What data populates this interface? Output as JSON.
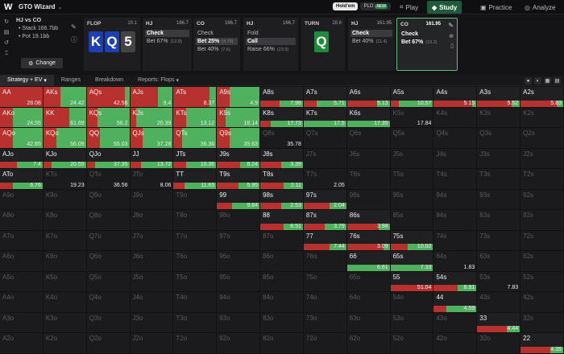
{
  "app": {
    "title": "GTO Wizard"
  },
  "game_toggle": {
    "holdem": "Hold'em",
    "plo": "PLO",
    "plo_badge": "NEW"
  },
  "nav": [
    {
      "label": "Play",
      "icon": "play-icon"
    },
    {
      "label": "Study",
      "icon": "study-icon"
    },
    {
      "label": "Practice",
      "icon": "practice-icon"
    },
    {
      "label": "Analyze",
      "icon": "analyze-icon"
    }
  ],
  "spot": {
    "title": "HJ vs CO",
    "stack": "Stack 166.7bb",
    "pot": "Pot 19.1bb",
    "change_label": "Change"
  },
  "flop": {
    "label": "FLOP",
    "value": "19.1",
    "cards": [
      "K",
      "Q",
      "5"
    ]
  },
  "turn": {
    "label": "TURN",
    "value": "28.6",
    "card": "Q"
  },
  "actions": [
    {
      "pos": "HJ",
      "eq": "166.7",
      "rows": [
        {
          "text": "Check",
          "sub": "",
          "hl": true
        },
        {
          "text": "Bet 67%",
          "sub": "(12.8)",
          "hl": false
        }
      ]
    },
    {
      "pos": "CO",
      "eq": "166.7",
      "rows": [
        {
          "text": "Check",
          "sub": "",
          "hl": false
        },
        {
          "text": "Bet 25%",
          "sub": "(4.75)",
          "hl": true
        },
        {
          "text": "Bet 40%",
          "sub": "(7.6)",
          "hl": false
        }
      ]
    },
    {
      "pos": "HJ",
      "eq": "166.7",
      "rows": [
        {
          "text": "Fold",
          "sub": "",
          "hl": false
        },
        {
          "text": "Call",
          "sub": "",
          "hl": true
        },
        {
          "text": "Raise 66%",
          "sub": "(23.5)",
          "hl": false
        }
      ]
    },
    {
      "pos": "HJ",
      "eq": "161.95",
      "rows": [
        {
          "text": "Check",
          "sub": "",
          "hl": true
        },
        {
          "text": "Bet 40%",
          "sub": "(11.4)",
          "hl": false
        }
      ]
    },
    {
      "pos": "CO",
      "eq": "161.95",
      "rows": [
        {
          "text": "Check",
          "sub": "",
          "hl": false
        },
        {
          "text": "Bet 67%",
          "sub": "(19.2)",
          "hl": false
        }
      ]
    }
  ],
  "tabs": [
    "Strategy + EV",
    "Ranges",
    "Breakdown",
    "Reports: Flops"
  ],
  "grid": [
    [
      [
        "AA",
        "28.08",
        100,
        1,
        1
      ],
      [
        "AKs",
        "24.42",
        100,
        1,
        0.4
      ],
      [
        "AQs",
        "42.56",
        100,
        1,
        0.9
      ],
      [
        "AJs",
        "9.4",
        100,
        1,
        0.65
      ],
      [
        "ATs",
        "8.37",
        100,
        1,
        0.85
      ],
      [
        "A9s",
        "4.9",
        100,
        1,
        0.3
      ],
      [
        "A8s",
        "7.96",
        30,
        0,
        0.45
      ],
      [
        "A7s",
        "5.71",
        30,
        0,
        0.3
      ],
      [
        "A6s",
        "5.13",
        30,
        0,
        0.7
      ],
      [
        "A5s",
        "10.57",
        30,
        0,
        0.2
      ],
      [
        "A4s",
        "5.15",
        30,
        0,
        0.9
      ],
      [
        "A3s",
        "5.52",
        30,
        0,
        0.8
      ],
      [
        "A2s",
        "5.83",
        30,
        0,
        0.85
      ]
    ],
    [
      [
        "AKo",
        "24.55",
        100,
        1,
        0.3
      ],
      [
        "KK",
        "61.69",
        100,
        1,
        0.6
      ],
      [
        "KQs",
        "56.2",
        100,
        1,
        0.25
      ],
      [
        "KJs",
        "20.39",
        100,
        1,
        0.15
      ],
      [
        "KTs",
        "13.12",
        100,
        1,
        0.3
      ],
      [
        "K9s",
        "18.14",
        100,
        1,
        0.2
      ],
      [
        "K8s",
        "17.73",
        30,
        0,
        0.25
      ],
      [
        "K7s",
        "17.5",
        30,
        0,
        0
      ],
      [
        "K6s",
        "17.35",
        30,
        0,
        0
      ],
      [
        "K5s",
        "17.84",
        0,
        0,
        0
      ],
      [
        "K4s",
        "",
        0,
        0,
        0
      ],
      [
        "K3s",
        "",
        0,
        0,
        0
      ],
      [
        "K2s",
        "",
        0,
        0,
        0
      ]
    ],
    [
      [
        "AQo",
        "42.65",
        100,
        1,
        0.3
      ],
      [
        "KQo",
        "56.09",
        100,
        1,
        0.3
      ],
      [
        "QQ",
        "55.03",
        100,
        1,
        0.3
      ],
      [
        "QJs",
        "37.28",
        100,
        1,
        0.3
      ],
      [
        "QTs",
        "36.36",
        100,
        1,
        0.2
      ],
      [
        "Q9s",
        "35.63",
        100,
        1,
        0.3
      ],
      [
        "Q8s",
        "35.78",
        0,
        0,
        0
      ],
      [
        "Q7s",
        "",
        0,
        0,
        0
      ],
      [
        "Q6s",
        "",
        0,
        0,
        0
      ],
      [
        "Q5s",
        "",
        0,
        0,
        0
      ],
      [
        "Q4s",
        "",
        0,
        0,
        0
      ],
      [
        "Q3s",
        "",
        0,
        0,
        0
      ],
      [
        "Q2s",
        "",
        0,
        0,
        0
      ]
    ],
    [
      [
        "AJo",
        "7.4",
        30,
        0,
        0.4
      ],
      [
        "KJo",
        "20.55",
        30,
        0,
        0.2
      ],
      [
        "QJo",
        "37.35",
        30,
        0,
        0.2
      ],
      [
        "JJ",
        "13.72",
        30,
        0,
        0.25
      ],
      [
        "JTs",
        "10.36",
        30,
        0,
        0.3
      ],
      [
        "J9s",
        "8.24",
        30,
        0,
        0.55
      ],
      [
        "J8s",
        "3.39",
        30,
        0,
        0.5
      ],
      [
        "J7s",
        "",
        0,
        0,
        0
      ],
      [
        "J6s",
        "",
        0,
        0,
        0
      ],
      [
        "J5s",
        "",
        0,
        0,
        0
      ],
      [
        "J4s",
        "",
        0,
        0,
        0
      ],
      [
        "J3s",
        "",
        0,
        0,
        0
      ],
      [
        "J2s",
        "",
        0,
        0,
        0
      ]
    ],
    [
      [
        "ATo",
        "6.76",
        30,
        0,
        0.3
      ],
      [
        "KTo",
        "19.23",
        0,
        0,
        0
      ],
      [
        "QTo",
        "36.56",
        0,
        0,
        0
      ],
      [
        "JTo",
        "8.06",
        0,
        0,
        0
      ],
      [
        "TT",
        "11.65",
        30,
        0,
        0.25
      ],
      [
        "T9s",
        "5.95",
        30,
        0,
        0.5
      ],
      [
        "T8s",
        "2.11",
        30,
        0,
        0.55
      ],
      [
        "T7s",
        "2.05",
        0,
        0,
        0
      ],
      [
        "T6s",
        "",
        0,
        0,
        0
      ],
      [
        "T5s",
        "",
        0,
        0,
        0
      ],
      [
        "T4s",
        "",
        0,
        0,
        0
      ],
      [
        "T3s",
        "",
        0,
        0,
        0
      ],
      [
        "T2s",
        "",
        0,
        0,
        0
      ]
    ],
    [
      [
        "A9o",
        "",
        0,
        0,
        0
      ],
      [
        "K9o",
        "",
        0,
        0,
        0
      ],
      [
        "Q9o",
        "",
        0,
        0,
        0
      ],
      [
        "J9o",
        "",
        0,
        0,
        0
      ],
      [
        "T9o",
        "",
        0,
        0,
        0
      ],
      [
        "99",
        "9.84",
        30,
        0,
        0.35
      ],
      [
        "98s",
        "2.53",
        30,
        0,
        0.5
      ],
      [
        "97s",
        "2.04",
        30,
        0,
        0.6
      ],
      [
        "96s",
        "",
        0,
        0,
        0
      ],
      [
        "95s",
        "",
        0,
        0,
        0
      ],
      [
        "94s",
        "",
        0,
        0,
        0
      ],
      [
        "93s",
        "",
        0,
        0,
        0
      ],
      [
        "92s",
        "",
        0,
        0,
        0
      ]
    ],
    [
      [
        "A8o",
        "",
        0,
        0,
        0
      ],
      [
        "K8o",
        "",
        0,
        0,
        0
      ],
      [
        "Q8o",
        "",
        0,
        0,
        0
      ],
      [
        "J8o",
        "",
        0,
        0,
        0
      ],
      [
        "T8o",
        "",
        0,
        0,
        0
      ],
      [
        "98o",
        "",
        0,
        0,
        0
      ],
      [
        "88",
        "8.51",
        30,
        0,
        0.55
      ],
      [
        "87s",
        "3.79",
        30,
        0,
        0.5
      ],
      [
        "86s",
        "3.98",
        30,
        0,
        0.75
      ],
      [
        "85s",
        "",
        0,
        0,
        0
      ],
      [
        "84s",
        "",
        0,
        0,
        0
      ],
      [
        "83s",
        "",
        0,
        0,
        0
      ],
      [
        "82s",
        "",
        0,
        0,
        0
      ]
    ],
    [
      [
        "A7o",
        "",
        0,
        0,
        0
      ],
      [
        "K7o",
        "",
        0,
        0,
        0
      ],
      [
        "Q7o",
        "",
        0,
        0,
        0
      ],
      [
        "J7o",
        "",
        0,
        0,
        0
      ],
      [
        "T7o",
        "",
        0,
        0,
        0
      ],
      [
        "97o",
        "",
        0,
        0,
        0
      ],
      [
        "87o",
        "",
        0,
        0,
        0
      ],
      [
        "77",
        "7.44",
        30,
        0,
        0.6
      ],
      [
        "76s",
        "3.09",
        30,
        0,
        0.85
      ],
      [
        "75s",
        "10.02",
        30,
        0,
        0.4
      ],
      [
        "74s",
        "",
        0,
        0,
        0
      ],
      [
        "73s",
        "",
        0,
        0,
        0
      ],
      [
        "72s",
        "",
        0,
        0,
        0
      ]
    ],
    [
      [
        "A6o",
        "",
        0,
        0,
        0
      ],
      [
        "K6o",
        "",
        0,
        0,
        0
      ],
      [
        "Q6o",
        "",
        0,
        0,
        0
      ],
      [
        "J6o",
        "",
        0,
        0,
        0
      ],
      [
        "T6o",
        "",
        0,
        0,
        0
      ],
      [
        "96o",
        "",
        0,
        0,
        0
      ],
      [
        "86o",
        "",
        0,
        0,
        0
      ],
      [
        "76o",
        "",
        0,
        0,
        0
      ],
      [
        "66",
        "6.61",
        30,
        0,
        0
      ],
      [
        "65s",
        "7.33",
        30,
        0,
        0
      ],
      [
        "64s",
        "1.83",
        0,
        0,
        0
      ],
      [
        "63s",
        "",
        0,
        0,
        0
      ],
      [
        "62s",
        "",
        0,
        0,
        0
      ]
    ],
    [
      [
        "A5o",
        "",
        0,
        0,
        0
      ],
      [
        "K5o",
        "",
        0,
        0,
        0
      ],
      [
        "Q5o",
        "",
        0,
        0,
        0
      ],
      [
        "J5o",
        "",
        0,
        0,
        0
      ],
      [
        "T5o",
        "",
        0,
        0,
        0
      ],
      [
        "95o",
        "",
        0,
        0,
        0
      ],
      [
        "85o",
        "",
        0,
        0,
        0
      ],
      [
        "75o",
        "",
        0,
        0,
        0
      ],
      [
        "65o",
        "",
        0,
        0,
        0
      ],
      [
        "55",
        "51.04",
        30,
        0,
        1
      ],
      [
        "54s",
        "6.91",
        30,
        0,
        0.55
      ],
      [
        "53s",
        "7.83",
        0,
        0,
        0
      ],
      [
        "52s",
        "",
        0,
        0,
        0
      ]
    ],
    [
      [
        "A4o",
        "",
        0,
        0,
        0
      ],
      [
        "K4o",
        "",
        0,
        0,
        0
      ],
      [
        "Q4o",
        "",
        0,
        0,
        0
      ],
      [
        "J4o",
        "",
        0,
        0,
        0
      ],
      [
        "T4o",
        "",
        0,
        0,
        0
      ],
      [
        "94o",
        "",
        0,
        0,
        0
      ],
      [
        "84o",
        "",
        0,
        0,
        0
      ],
      [
        "74o",
        "",
        0,
        0,
        0
      ],
      [
        "64o",
        "",
        0,
        0,
        0
      ],
      [
        "54o",
        "",
        0,
        0,
        0
      ],
      [
        "44",
        "4.59",
        30,
        0,
        0.3
      ],
      [
        "43s",
        "",
        0,
        0,
        0
      ],
      [
        "42s",
        "",
        0,
        0,
        0
      ]
    ],
    [
      [
        "A3o",
        "",
        0,
        0,
        0
      ],
      [
        "K3o",
        "",
        0,
        0,
        0
      ],
      [
        "Q3o",
        "",
        0,
        0,
        0
      ],
      [
        "J3o",
        "",
        0,
        0,
        0
      ],
      [
        "T3o",
        "",
        0,
        0,
        0
      ],
      [
        "93o",
        "",
        0,
        0,
        0
      ],
      [
        "83o",
        "",
        0,
        0,
        0
      ],
      [
        "73o",
        "",
        0,
        0,
        0
      ],
      [
        "63o",
        "",
        0,
        0,
        0
      ],
      [
        "53o",
        "",
        0,
        0,
        0
      ],
      [
        "43o",
        "",
        0,
        0,
        0
      ],
      [
        "33",
        "4.44",
        30,
        0,
        0.7
      ],
      [
        "32s",
        "",
        0,
        0,
        0
      ]
    ],
    [
      [
        "A2o",
        "",
        0,
        0,
        0
      ],
      [
        "K2o",
        "",
        0,
        0,
        0
      ],
      [
        "Q2o",
        "",
        0,
        0,
        0
      ],
      [
        "J2o",
        "",
        0,
        0,
        0
      ],
      [
        "T2o",
        "",
        0,
        0,
        0
      ],
      [
        "92o",
        "",
        0,
        0,
        0
      ],
      [
        "82o",
        "",
        0,
        0,
        0
      ],
      [
        "72o",
        "",
        0,
        0,
        0
      ],
      [
        "62o",
        "",
        0,
        0,
        0
      ],
      [
        "52o",
        "",
        0,
        0,
        0
      ],
      [
        "42o",
        "",
        0,
        0,
        0
      ],
      [
        "32o",
        "",
        0,
        0,
        0
      ],
      [
        "22",
        "4.35",
        30,
        0,
        0.7
      ]
    ]
  ]
}
